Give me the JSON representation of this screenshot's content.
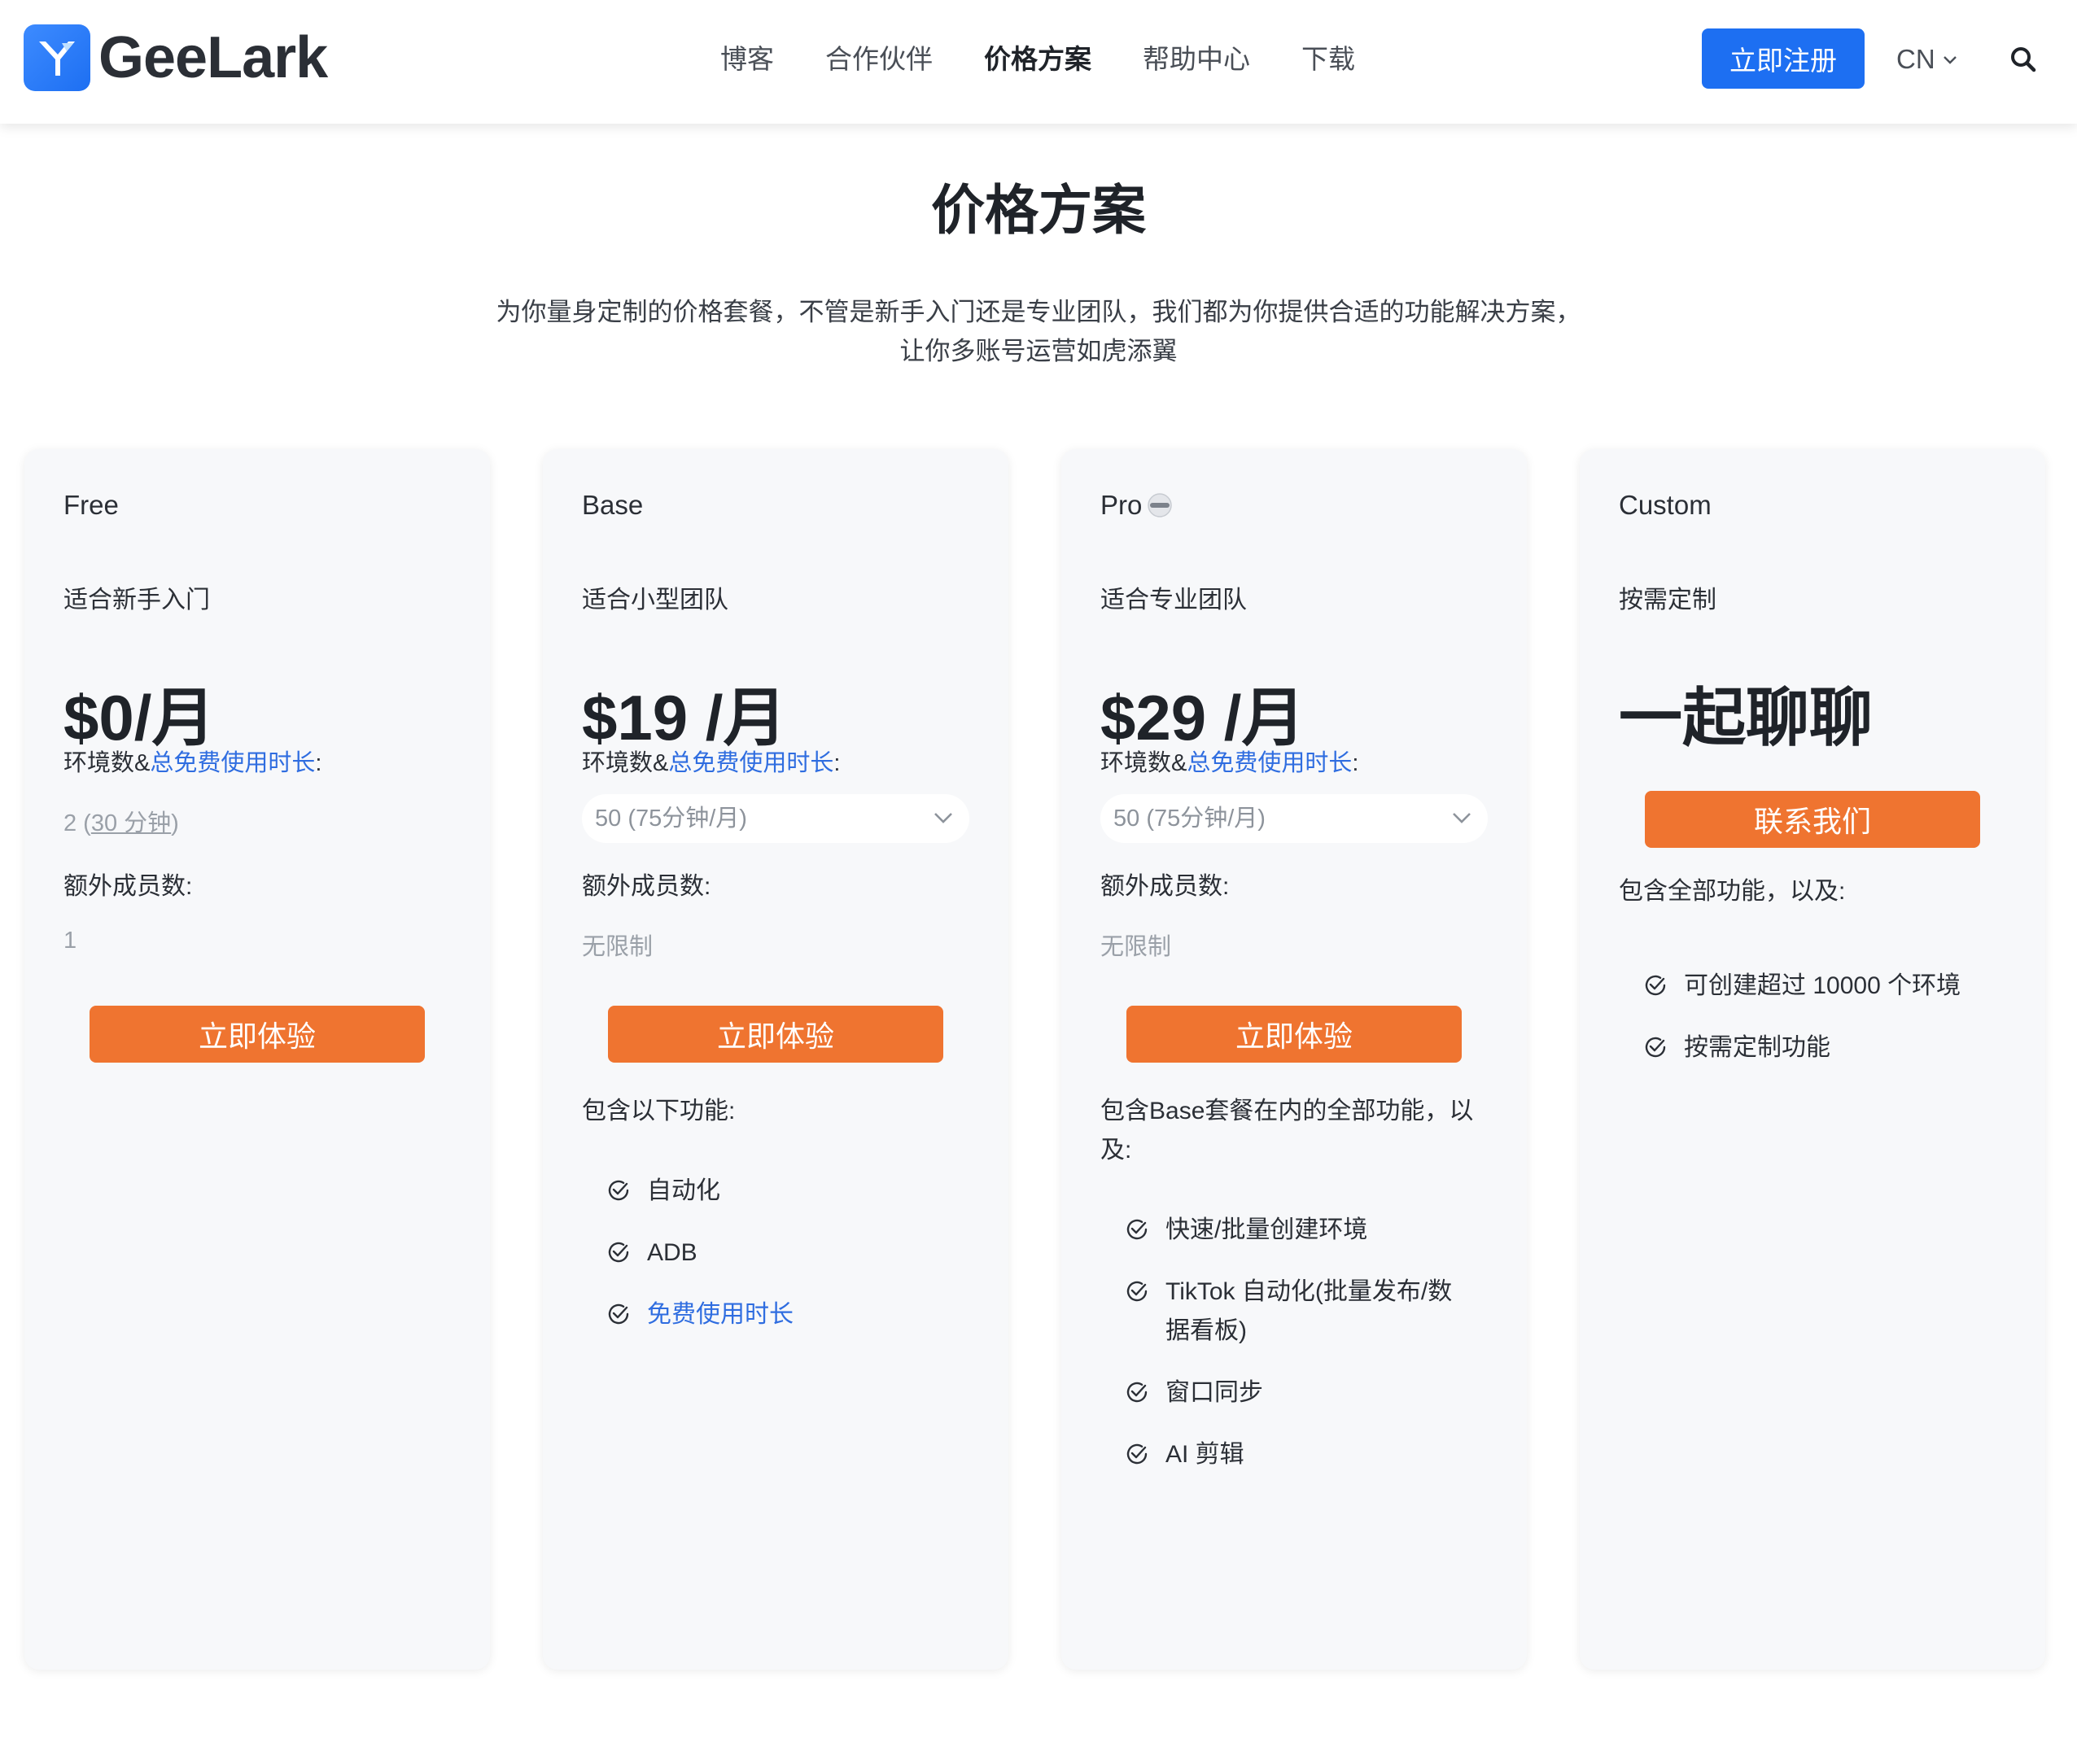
{
  "header": {
    "logo_text": "GeeLark",
    "nav": [
      "博客",
      "合作伙伴",
      "价格方案",
      "帮助中心",
      "下载"
    ],
    "signup": "立即注册",
    "lang": "CN"
  },
  "intro": {
    "title": "价格方案",
    "desc": "为你量身定制的价格套餐，不管是新手入门还是专业团队，我们都为你提供合适的功能解决方案，让你多账号运营如虎添翼"
  },
  "plans": [
    {
      "name": "Free",
      "subtitle": "适合新手入门",
      "price": "$0/月",
      "env_label_a": "环境数&",
      "env_label_b": "总免费使用时长",
      "env_label_c": ":",
      "env_value_a": "2 (",
      "env_value_b": "30 分钟",
      "env_value_c": ")",
      "extra_label": "额外成员数:",
      "extra_value": "1",
      "cta": "立即体验"
    },
    {
      "name": "Base",
      "subtitle": "适合小型团队",
      "price": "$19 /月",
      "env_label_a": "环境数&",
      "env_label_b": "总免费使用时长",
      "env_label_c": ":",
      "env_select": "50 (75分钟/月)",
      "extra_label": "额外成员数:",
      "extra_value": "无限制",
      "cta": "立即体验",
      "includes": "包含以下功能:",
      "features": [
        "自动化",
        "ADB",
        "免费使用时长"
      ]
    },
    {
      "name": "Pro",
      "subtitle": "适合专业团队",
      "price": "$29 /月",
      "env_label_a": "环境数&",
      "env_label_b": "总免费使用时长",
      "env_label_c": ":",
      "env_select": "50 (75分钟/月)",
      "extra_label": "额外成员数:",
      "extra_value": "无限制",
      "cta": "立即体验",
      "includes": "包含Base套餐在内的全部功能，以及:",
      "features": [
        "快速/批量创建环境",
        "TikTok 自动化(批量发布/数据看板)",
        "窗口同步",
        "AI 剪辑"
      ]
    },
    {
      "name": "Custom",
      "subtitle": "按需定制",
      "price": "一起聊聊",
      "cta": "联系我们",
      "includes": "包含全部功能，以及:",
      "features": [
        "可创建超过 10000 个环境",
        "按需定制功能"
      ]
    }
  ],
  "colors": {
    "primary": "#1d6ff2",
    "cta": "#ef7430",
    "link": "#2f6de0",
    "card_bg": "#f7f8fa"
  },
  "icons": {
    "check": "check-circle-icon",
    "chevron": "chevron-down-icon",
    "search": "search-icon",
    "pro": "pro-badge-icon"
  }
}
